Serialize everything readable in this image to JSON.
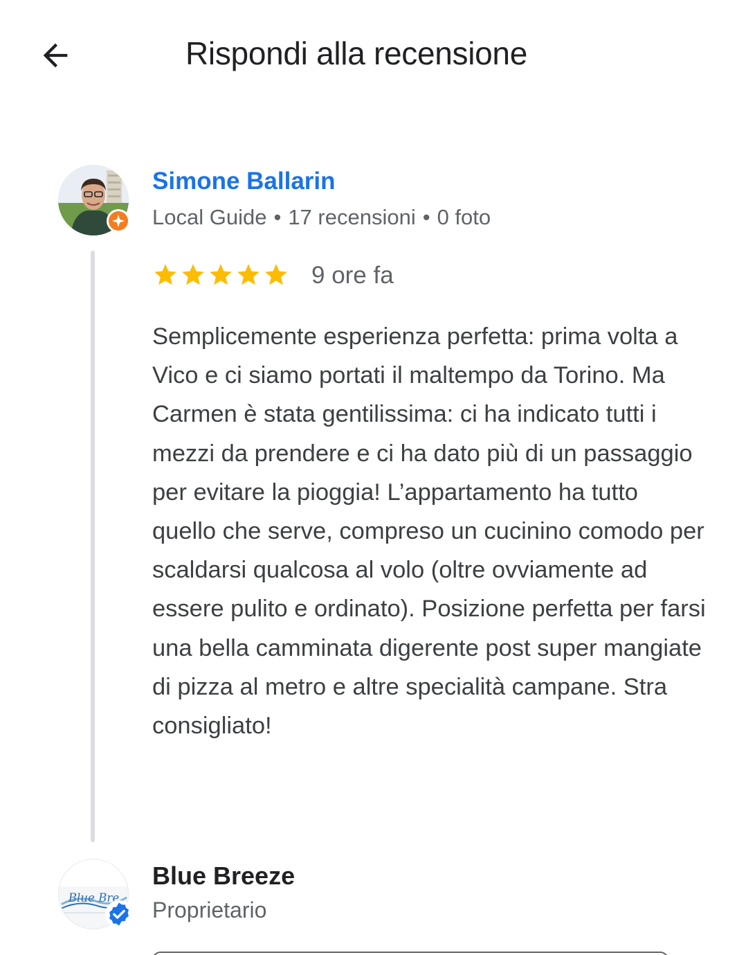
{
  "header": {
    "back_icon": "arrow-left-icon",
    "title": "Rispondi alla recensione"
  },
  "review": {
    "reviewer_name": "Simone Ballarin",
    "reviewer_badge_icon": "local-guide-icon",
    "reviewer_type": "Local Guide",
    "separator": "•",
    "reviews_count": "17 recensioni",
    "photos_count": "0 foto",
    "rating": 5,
    "rating_max": 5,
    "star_color": "#fbbc04",
    "time": "9 ore fa",
    "text": "Semplicemente esperienza perfetta: prima volta a Vico e ci siamo portati il maltempo da Torino. Ma Carmen è stata gentilissima: ci ha indicato tutti i mezzi da prendere e ci ha dato più di un passaggio per evitare la pioggia! L’appartamento ha tutto quello che serve, compreso un cucinino comodo per scaldarsi qualcosa al volo (oltre ovviamente ad essere pulito e ordinato). Posizione perfetta per farsi una bella camminata digerente post super mangiate di pizza al metro e altre specialità campane. Stra consigliato!"
  },
  "owner": {
    "name": "Blue Breeze",
    "role": "Proprietario",
    "logo_text": "Blue Bre",
    "verified_icon": "verified-check-icon"
  },
  "colors": {
    "link_blue": "#1a73e8",
    "text_primary": "#202124",
    "text_secondary": "#5f6368",
    "thread_line": "#dadce0"
  }
}
